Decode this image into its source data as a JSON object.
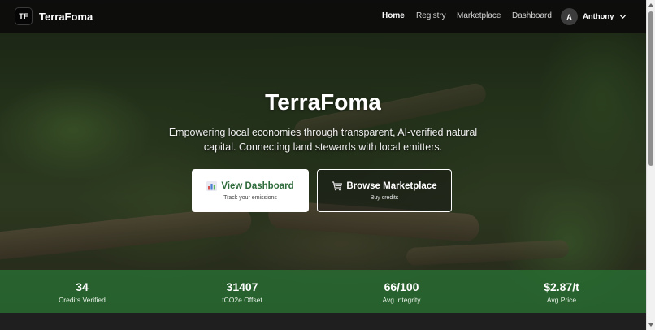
{
  "brand": {
    "logo_text": "TF",
    "name": "TerraFoma"
  },
  "nav": {
    "links": [
      "Home",
      "Registry",
      "Marketplace",
      "Dashboard"
    ],
    "active": "Home"
  },
  "user": {
    "initial": "A",
    "name": "Anthony",
    "menu_icon": "chevron-down-icon"
  },
  "hero": {
    "title": "TerraFoma",
    "subtitle": "Empowering local economies through transparent, AI-verified natural capital. Connecting land stewards with local emitters.",
    "primary_button": {
      "icon": "bar-chart-icon",
      "label": "View Dashboard",
      "caption": "Track your emissions"
    },
    "secondary_button": {
      "icon": "cart-icon",
      "label": "Browse Marketplace",
      "caption": "Buy credits"
    }
  },
  "stats": [
    {
      "value": "34",
      "label": "Credits Verified"
    },
    {
      "value": "31407",
      "label": "tCO2e Offset"
    },
    {
      "value": "66/100",
      "label": "Avg Integrity"
    },
    {
      "value": "$2.87/t",
      "label": "Avg Price"
    }
  ],
  "colors": {
    "accent_green": "#2e6b3a",
    "stats_band": "#286e32",
    "navbar": "#0c0c0c"
  }
}
